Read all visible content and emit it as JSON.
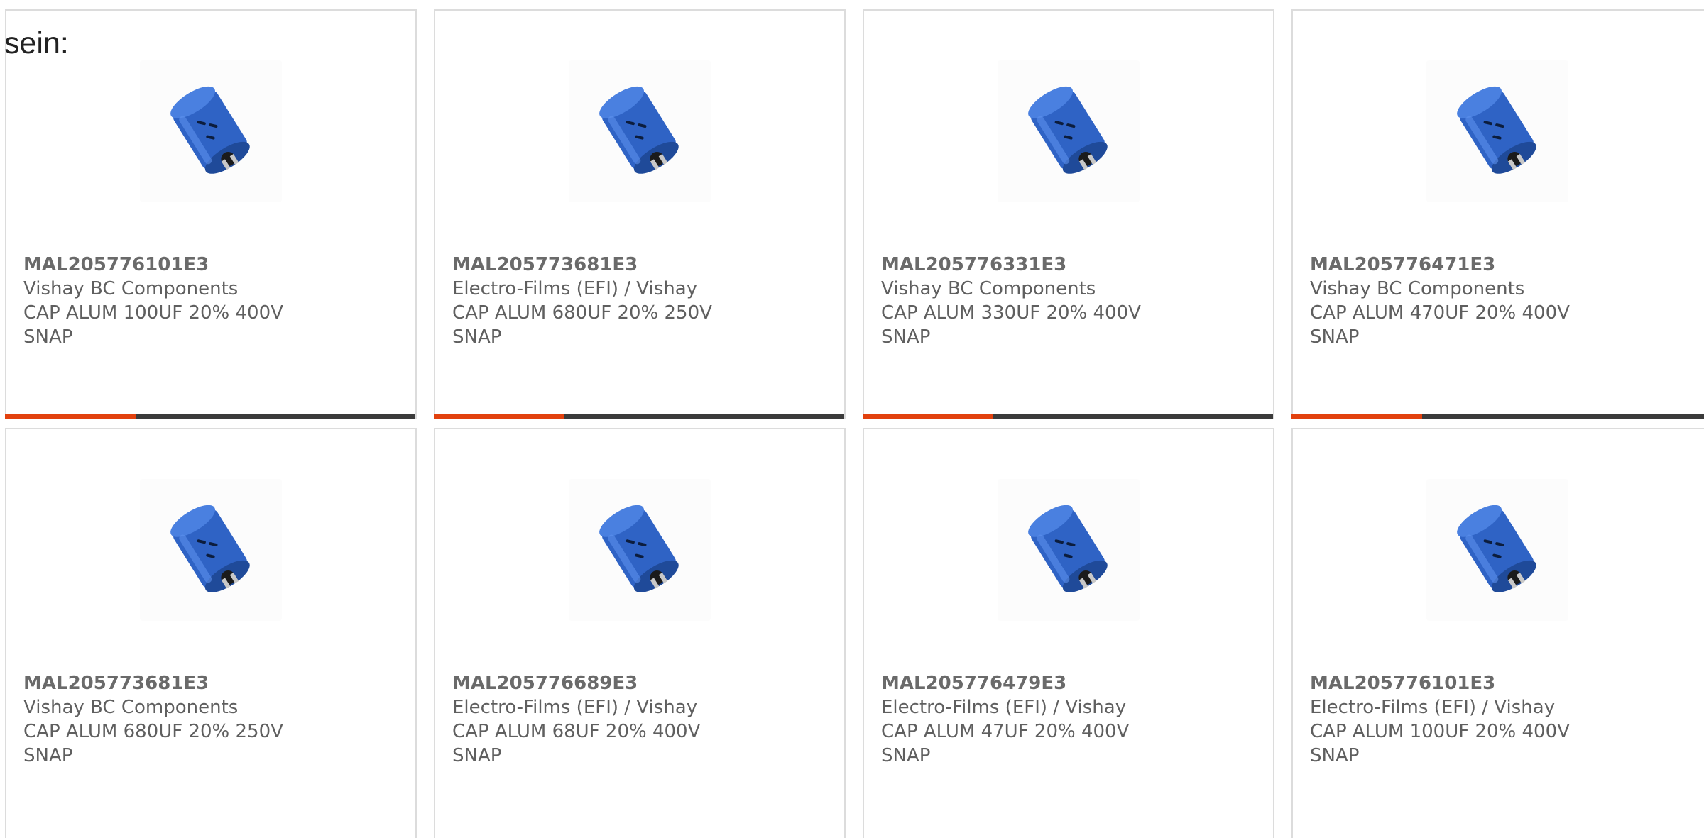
{
  "intro_text": "sein:",
  "colors": {
    "accent": "#e2410e",
    "bar": "#3b3b3b",
    "capacitor": "#2f63c5",
    "text": "#5f5f5f"
  },
  "products": [
    {
      "part_number": "MAL205776101E3",
      "manufacturer": "Vishay BC Components",
      "description": "CAP ALUM 100UF 20% 400V SNAP",
      "image_icon": "capacitor-image"
    },
    {
      "part_number": "MAL205773681E3",
      "manufacturer": "Electro-Films (EFI) / Vishay",
      "description": "CAP ALUM 680UF 20% 250V SNAP",
      "image_icon": "capacitor-image"
    },
    {
      "part_number": "MAL205776331E3",
      "manufacturer": "Vishay BC Components",
      "description": "CAP ALUM 330UF 20% 400V SNAP",
      "image_icon": "capacitor-image"
    },
    {
      "part_number": "MAL205776471E3",
      "manufacturer": "Vishay BC Components",
      "description": "CAP ALUM 470UF 20% 400V SNAP",
      "image_icon": "capacitor-image"
    },
    {
      "part_number": "MAL205773681E3",
      "manufacturer": "Vishay BC Components",
      "description": "CAP ALUM 680UF 20% 250V SNAP",
      "image_icon": "capacitor-image"
    },
    {
      "part_number": "MAL205776689E3",
      "manufacturer": "Electro-Films (EFI) / Vishay",
      "description": "CAP ALUM 68UF 20% 400V SNAP",
      "image_icon": "capacitor-image"
    },
    {
      "part_number": "MAL205776479E3",
      "manufacturer": "Electro-Films (EFI) / Vishay",
      "description": "CAP ALUM 47UF 20% 400V SNAP",
      "image_icon": "capacitor-image"
    },
    {
      "part_number": "MAL205776101E3",
      "manufacturer": "Electro-Films (EFI) / Vishay",
      "description": "CAP ALUM 100UF 20% 400V SNAP",
      "image_icon": "capacitor-image"
    }
  ]
}
